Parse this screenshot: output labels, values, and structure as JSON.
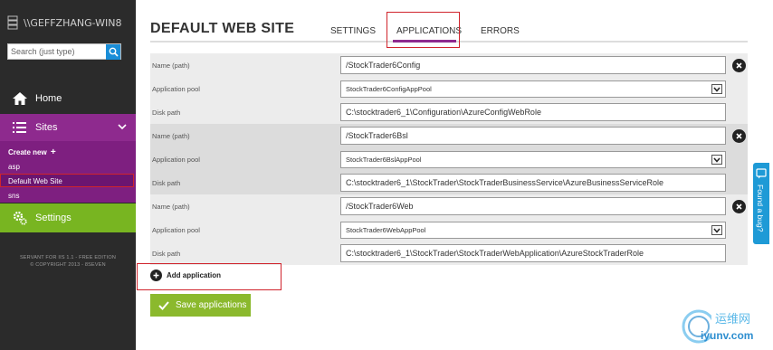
{
  "sidebar": {
    "server_name": "\\\\GEFFZHANG-WIN8",
    "search_placeholder": "Search (just type)",
    "home_label": "Home",
    "sites_label": "Sites",
    "create_new_label": "Create new",
    "sites": [
      "asp",
      "Default Web Site",
      "sns"
    ],
    "settings_label": "Settings",
    "footer_line1": "SERVANT FOR IIS 1.1 - FREE EDITION",
    "footer_line2": "© COPYRIGHT 2013 - 8SEVEN"
  },
  "main": {
    "title": "DEFAULT WEB SITE",
    "tabs": [
      {
        "label": "SETTINGS"
      },
      {
        "label": "APPLICATIONS",
        "active": true
      },
      {
        "label": "ERRORS"
      }
    ],
    "labels": {
      "name": "Name (path)",
      "pool": "Application pool",
      "disk": "Disk path"
    },
    "applications": [
      {
        "name": "/StockTrader6Config",
        "pool": "StockTrader6ConfigAppPool",
        "disk": "C:\\stocktrader6_1\\Configuration\\AzureConfigWebRole"
      },
      {
        "name": "/StockTrader6Bsl",
        "pool": "StockTrader6BslAppPool",
        "disk": "C:\\stocktrader6_1\\StockTrader\\StockTraderBusinessService\\AzureBusinessServiceRole"
      },
      {
        "name": "/StockTrader6Web",
        "pool": "StockTrader6WebAppPool",
        "disk": "C:\\stocktrader6_1\\StockTrader\\StockTraderWebApplication\\AzureStockTraderRole"
      }
    ],
    "add_application_label": "Add application",
    "save_label": "Save applications",
    "feedback_label": "Found a bug?"
  },
  "watermark": {
    "cn": "运维网",
    "url": "iyunv.com"
  },
  "colors": {
    "sidebar_bg": "#2b2b2b",
    "sites_purple": "#8e2a8e",
    "settings_green": "#78b521",
    "save_green": "#8bb92d",
    "highlight_red": "#d0242c",
    "feedback_blue": "#1e9ad6"
  }
}
